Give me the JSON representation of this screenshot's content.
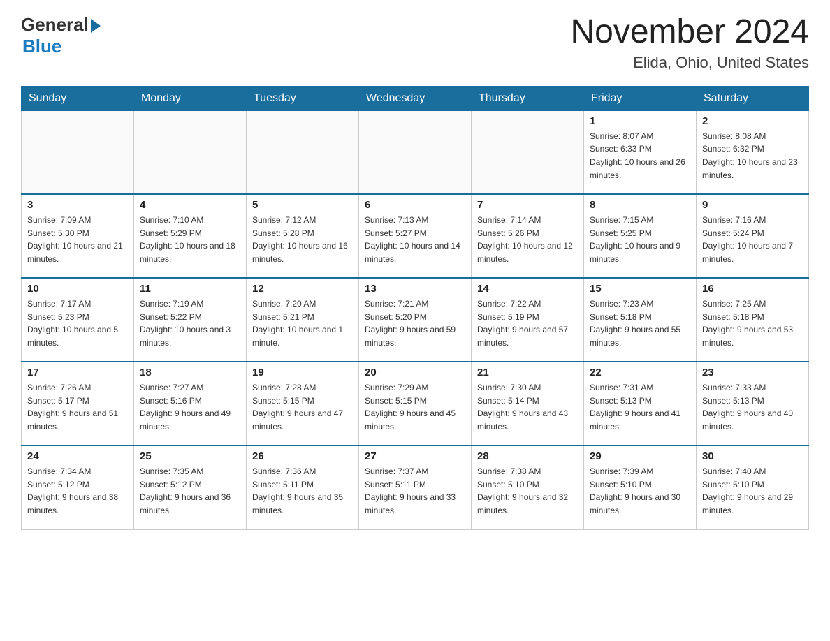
{
  "logo": {
    "general": "General",
    "blue": "Blue"
  },
  "title": {
    "month_year": "November 2024",
    "location": "Elida, Ohio, United States"
  },
  "days_of_week": [
    "Sunday",
    "Monday",
    "Tuesday",
    "Wednesday",
    "Thursday",
    "Friday",
    "Saturday"
  ],
  "weeks": [
    [
      {
        "day": "",
        "sunrise": "",
        "sunset": "",
        "daylight": ""
      },
      {
        "day": "",
        "sunrise": "",
        "sunset": "",
        "daylight": ""
      },
      {
        "day": "",
        "sunrise": "",
        "sunset": "",
        "daylight": ""
      },
      {
        "day": "",
        "sunrise": "",
        "sunset": "",
        "daylight": ""
      },
      {
        "day": "",
        "sunrise": "",
        "sunset": "",
        "daylight": ""
      },
      {
        "day": "1",
        "sunrise": "Sunrise: 8:07 AM",
        "sunset": "Sunset: 6:33 PM",
        "daylight": "Daylight: 10 hours and 26 minutes."
      },
      {
        "day": "2",
        "sunrise": "Sunrise: 8:08 AM",
        "sunset": "Sunset: 6:32 PM",
        "daylight": "Daylight: 10 hours and 23 minutes."
      }
    ],
    [
      {
        "day": "3",
        "sunrise": "Sunrise: 7:09 AM",
        "sunset": "Sunset: 5:30 PM",
        "daylight": "Daylight: 10 hours and 21 minutes."
      },
      {
        "day": "4",
        "sunrise": "Sunrise: 7:10 AM",
        "sunset": "Sunset: 5:29 PM",
        "daylight": "Daylight: 10 hours and 18 minutes."
      },
      {
        "day": "5",
        "sunrise": "Sunrise: 7:12 AM",
        "sunset": "Sunset: 5:28 PM",
        "daylight": "Daylight: 10 hours and 16 minutes."
      },
      {
        "day": "6",
        "sunrise": "Sunrise: 7:13 AM",
        "sunset": "Sunset: 5:27 PM",
        "daylight": "Daylight: 10 hours and 14 minutes."
      },
      {
        "day": "7",
        "sunrise": "Sunrise: 7:14 AM",
        "sunset": "Sunset: 5:26 PM",
        "daylight": "Daylight: 10 hours and 12 minutes."
      },
      {
        "day": "8",
        "sunrise": "Sunrise: 7:15 AM",
        "sunset": "Sunset: 5:25 PM",
        "daylight": "Daylight: 10 hours and 9 minutes."
      },
      {
        "day": "9",
        "sunrise": "Sunrise: 7:16 AM",
        "sunset": "Sunset: 5:24 PM",
        "daylight": "Daylight: 10 hours and 7 minutes."
      }
    ],
    [
      {
        "day": "10",
        "sunrise": "Sunrise: 7:17 AM",
        "sunset": "Sunset: 5:23 PM",
        "daylight": "Daylight: 10 hours and 5 minutes."
      },
      {
        "day": "11",
        "sunrise": "Sunrise: 7:19 AM",
        "sunset": "Sunset: 5:22 PM",
        "daylight": "Daylight: 10 hours and 3 minutes."
      },
      {
        "day": "12",
        "sunrise": "Sunrise: 7:20 AM",
        "sunset": "Sunset: 5:21 PM",
        "daylight": "Daylight: 10 hours and 1 minute."
      },
      {
        "day": "13",
        "sunrise": "Sunrise: 7:21 AM",
        "sunset": "Sunset: 5:20 PM",
        "daylight": "Daylight: 9 hours and 59 minutes."
      },
      {
        "day": "14",
        "sunrise": "Sunrise: 7:22 AM",
        "sunset": "Sunset: 5:19 PM",
        "daylight": "Daylight: 9 hours and 57 minutes."
      },
      {
        "day": "15",
        "sunrise": "Sunrise: 7:23 AM",
        "sunset": "Sunset: 5:18 PM",
        "daylight": "Daylight: 9 hours and 55 minutes."
      },
      {
        "day": "16",
        "sunrise": "Sunrise: 7:25 AM",
        "sunset": "Sunset: 5:18 PM",
        "daylight": "Daylight: 9 hours and 53 minutes."
      }
    ],
    [
      {
        "day": "17",
        "sunrise": "Sunrise: 7:26 AM",
        "sunset": "Sunset: 5:17 PM",
        "daylight": "Daylight: 9 hours and 51 minutes."
      },
      {
        "day": "18",
        "sunrise": "Sunrise: 7:27 AM",
        "sunset": "Sunset: 5:16 PM",
        "daylight": "Daylight: 9 hours and 49 minutes."
      },
      {
        "day": "19",
        "sunrise": "Sunrise: 7:28 AM",
        "sunset": "Sunset: 5:15 PM",
        "daylight": "Daylight: 9 hours and 47 minutes."
      },
      {
        "day": "20",
        "sunrise": "Sunrise: 7:29 AM",
        "sunset": "Sunset: 5:15 PM",
        "daylight": "Daylight: 9 hours and 45 minutes."
      },
      {
        "day": "21",
        "sunrise": "Sunrise: 7:30 AM",
        "sunset": "Sunset: 5:14 PM",
        "daylight": "Daylight: 9 hours and 43 minutes."
      },
      {
        "day": "22",
        "sunrise": "Sunrise: 7:31 AM",
        "sunset": "Sunset: 5:13 PM",
        "daylight": "Daylight: 9 hours and 41 minutes."
      },
      {
        "day": "23",
        "sunrise": "Sunrise: 7:33 AM",
        "sunset": "Sunset: 5:13 PM",
        "daylight": "Daylight: 9 hours and 40 minutes."
      }
    ],
    [
      {
        "day": "24",
        "sunrise": "Sunrise: 7:34 AM",
        "sunset": "Sunset: 5:12 PM",
        "daylight": "Daylight: 9 hours and 38 minutes."
      },
      {
        "day": "25",
        "sunrise": "Sunrise: 7:35 AM",
        "sunset": "Sunset: 5:12 PM",
        "daylight": "Daylight: 9 hours and 36 minutes."
      },
      {
        "day": "26",
        "sunrise": "Sunrise: 7:36 AM",
        "sunset": "Sunset: 5:11 PM",
        "daylight": "Daylight: 9 hours and 35 minutes."
      },
      {
        "day": "27",
        "sunrise": "Sunrise: 7:37 AM",
        "sunset": "Sunset: 5:11 PM",
        "daylight": "Daylight: 9 hours and 33 minutes."
      },
      {
        "day": "28",
        "sunrise": "Sunrise: 7:38 AM",
        "sunset": "Sunset: 5:10 PM",
        "daylight": "Daylight: 9 hours and 32 minutes."
      },
      {
        "day": "29",
        "sunrise": "Sunrise: 7:39 AM",
        "sunset": "Sunset: 5:10 PM",
        "daylight": "Daylight: 9 hours and 30 minutes."
      },
      {
        "day": "30",
        "sunrise": "Sunrise: 7:40 AM",
        "sunset": "Sunset: 5:10 PM",
        "daylight": "Daylight: 9 hours and 29 minutes."
      }
    ]
  ]
}
